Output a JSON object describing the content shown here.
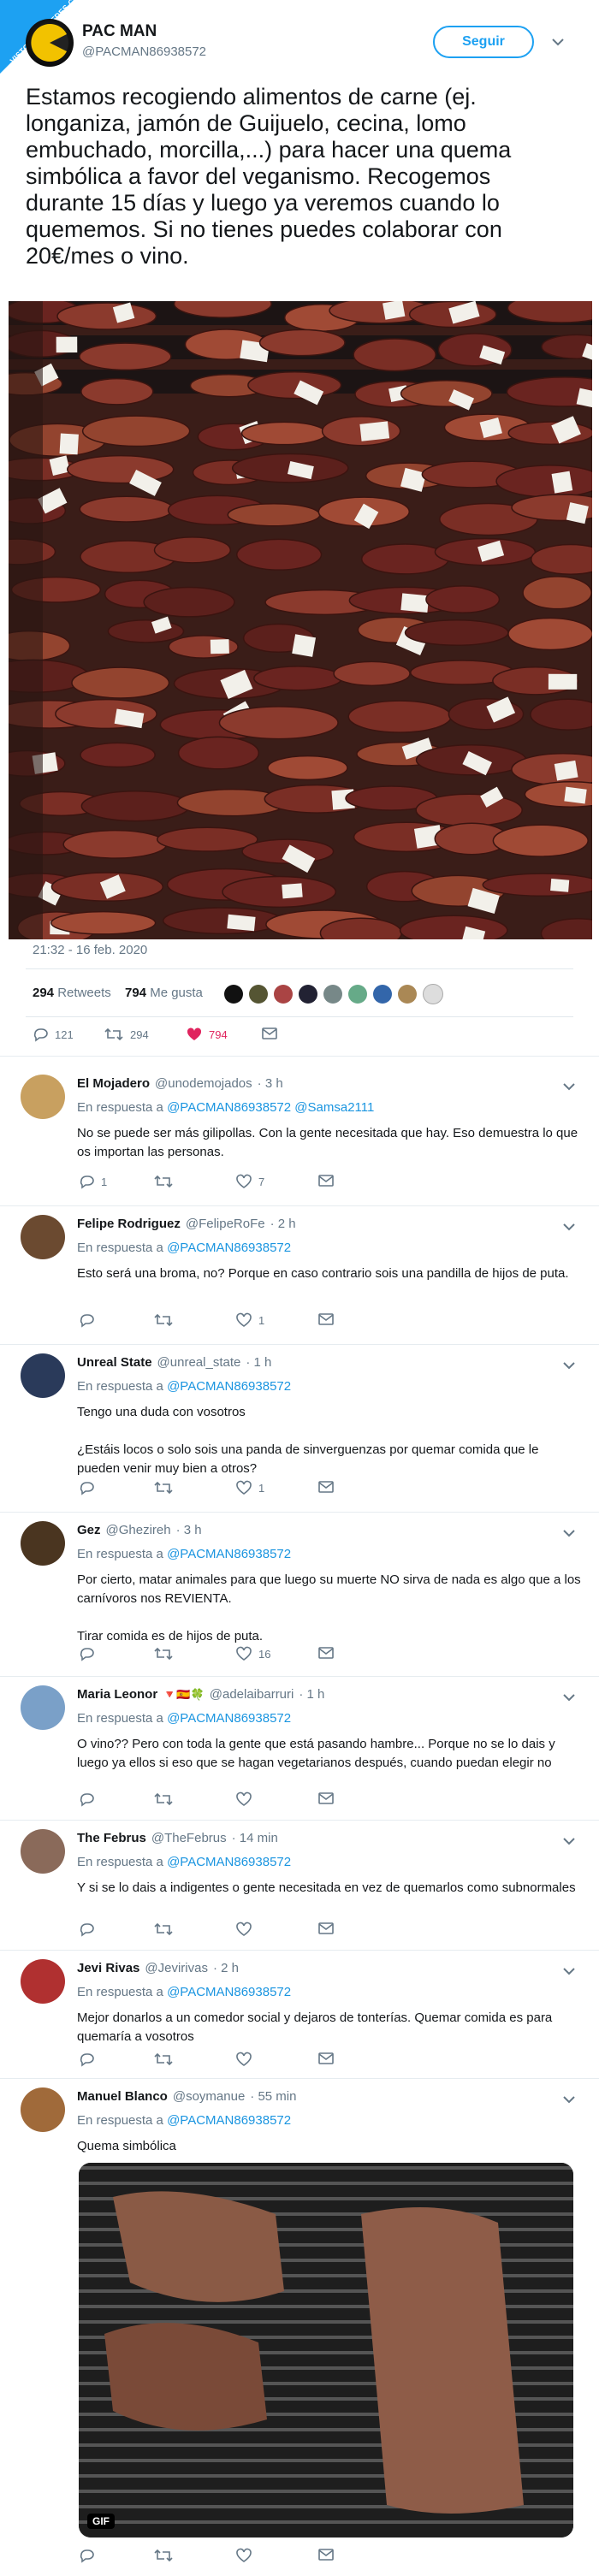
{
  "corner_badge": "VISTOENLASREDES.COM",
  "tweet": {
    "name": "PAC MAN",
    "handle": "@PACMAN86938572",
    "follow_label": "Seguir",
    "text": "Estamos recogiendo alimentos de carne (ej. longaniza, jamón de Guijuelo, cecina, lomo embuchado, morcilla,...) para hacer una quema simbólica a favor del veganismo. Recogemos durante 15 días y luego ya veremos cuando lo quememos. Si no tienes puedes colaborar con 20€/mes o vino.",
    "timestamp": "21:32 - 16 feb. 2020",
    "retweets_count": "294",
    "retweets_label": "Retweets",
    "likes_count": "794",
    "likes_label": "Me gusta",
    "action_replies": "121",
    "action_retweets": "294",
    "action_likes": "794"
  },
  "colors": {
    "accent": "#1da1f2",
    "like": "#e0245e",
    "muted": "#657786",
    "link": "#1b95e0"
  },
  "in_reply_label": "En respuesta a",
  "replies": [
    {
      "name": "El Mojadero",
      "handle": "@unodemojados",
      "time": "· 3 h",
      "reply_to": [
        "@PACMAN86938572",
        "@Samsa2111"
      ],
      "text": "No se puede ser más gilipollas. Con la gente necesitada que hay. Eso demuestra lo que os importan las personas.",
      "replies": "1",
      "retweets": "",
      "likes": "7"
    },
    {
      "name": "Felipe Rodriguez",
      "handle": "@FelipeRoFe",
      "time": "· 2 h",
      "reply_to": [
        "@PACMAN86938572"
      ],
      "text": "Esto será una broma, no? Porque en caso contrario sois una pandilla de hijos de puta.",
      "replies": "",
      "retweets": "",
      "likes": "1"
    },
    {
      "name": "Unreal State",
      "handle": "@unreal_state",
      "time": "· 1 h",
      "reply_to": [
        "@PACMAN86938572"
      ],
      "text": "Tengo una duda con vosotros",
      "text2": "¿Estáis locos o solo sois una panda de sinverguenzas por quemar comida que le pueden venir muy bien a otros?",
      "replies": "",
      "retweets": "",
      "likes": "1"
    },
    {
      "name": "Gez",
      "handle": "@Ghezireh",
      "time": "· 3 h",
      "reply_to": [
        "@PACMAN86938572"
      ],
      "text": "Por cierto, matar animales para que luego su muerte NO sirva de nada es algo que a los carnívoros nos REVIENTA.",
      "text2": "Tirar comida es de hijos de puta.",
      "replies": "",
      "retweets": "",
      "likes": "16"
    },
    {
      "name": "Maria Leonor",
      "emoji": "🔻🇪🇸🍀",
      "handle": "@adelaibarruri",
      "time": "· 1 h",
      "reply_to": [
        "@PACMAN86938572"
      ],
      "text": "O vino?? Pero con toda la gente que está pasando hambre... Porque no se lo dais y luego ya ellos si eso que se hagan vegetarianos después, cuando puedan elegir no",
      "replies": "",
      "retweets": "",
      "likes": ""
    },
    {
      "name": "The Februs",
      "handle": "@TheFebrus",
      "time": "· 14 min",
      "reply_to": [
        "@PACMAN86938572"
      ],
      "text": "Y si se lo dais a indigentes o gente necesitada en vez de quemarlos como subnormales",
      "replies": "",
      "retweets": "",
      "likes": ""
    },
    {
      "name": "Jevi Rivas",
      "handle": "@Jevirivas",
      "time": "· 2 h",
      "reply_to": [
        "@PACMAN86938572"
      ],
      "text": "Mejor donarlos a un comedor social y dejaros de tonterías. Quemar comida es para quemaría a vosotros",
      "replies": "",
      "retweets": "",
      "likes": ""
    },
    {
      "name": "Manuel Blanco",
      "handle": "@soymanue",
      "time": "· 55 min",
      "reply_to": [
        "@PACMAN86938572"
      ],
      "text": "Quema simbólica",
      "gif_label": "GIF",
      "replies": "",
      "retweets": "",
      "likes": ""
    }
  ]
}
